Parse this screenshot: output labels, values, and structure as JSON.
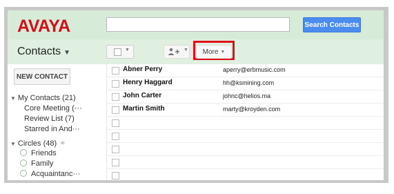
{
  "header": {
    "logo": "AVAYA",
    "search_button": "Search Contacts",
    "search_value": ""
  },
  "toolbar": {
    "title": "Contacts",
    "more_label": "More"
  },
  "sidebar": {
    "new_contact": "NEW CONTACT",
    "items": [
      {
        "label": "My Contacts (21)"
      },
      {
        "label": "Core Meeting (···"
      },
      {
        "label": "Review List (7)"
      },
      {
        "label": "Starred in And···"
      },
      {
        "label": "Circles (48)"
      },
      {
        "label": "Friends"
      },
      {
        "label": "Family"
      },
      {
        "label": "Acquaintanc···"
      }
    ]
  },
  "contacts": [
    {
      "name": "Abner Perry",
      "email": "aperry@erbmusic.com"
    },
    {
      "name": "Henry Haggard",
      "email": "hh@ksmining.com"
    },
    {
      "name": "John Carter",
      "email": "johnc@helios.ma"
    },
    {
      "name": "Martin Smith",
      "email": "marty@kroyden.com"
    }
  ],
  "colors": {
    "brand_red": "#d0101a",
    "header_green": "#d6ecd8",
    "search_blue": "#4a8cf0",
    "highlight_red": "#e0101a"
  }
}
